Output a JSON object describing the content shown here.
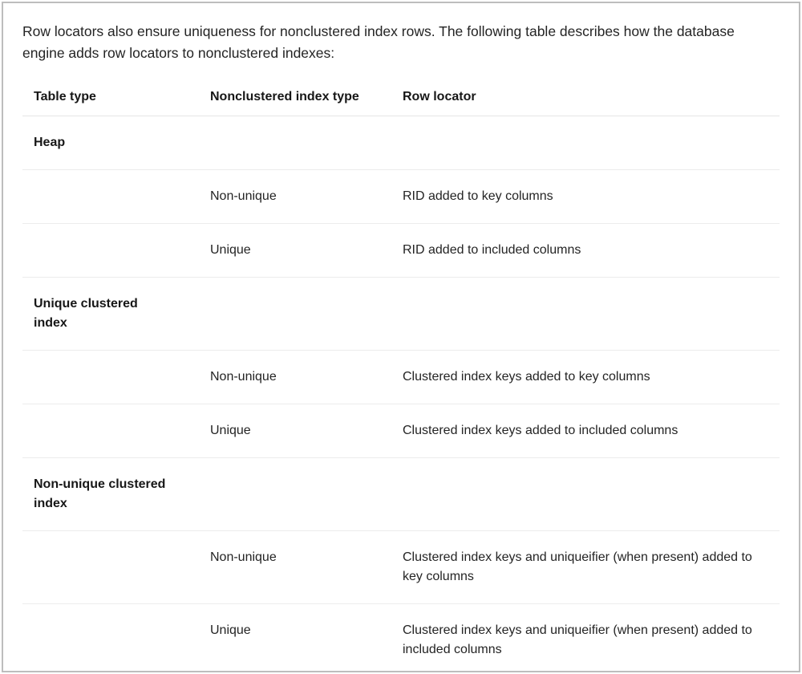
{
  "intro": "Row locators also ensure uniqueness for nonclustered index rows. The following table describes how the database engine adds row locators to nonclustered indexes:",
  "headers": {
    "col1": "Table type",
    "col2": "Nonclustered index type",
    "col3": "Row locator"
  },
  "rows": [
    {
      "c1": "Heap",
      "c2": "",
      "c3": "",
      "group": true
    },
    {
      "c1": "",
      "c2": "Non-unique",
      "c3": "RID added to key columns",
      "group": false
    },
    {
      "c1": "",
      "c2": "Unique",
      "c3": "RID added to included columns",
      "group": false
    },
    {
      "c1": "Unique clustered index",
      "c2": "",
      "c3": "",
      "group": true
    },
    {
      "c1": "",
      "c2": "Non-unique",
      "c3": "Clustered index keys added to key columns",
      "group": false
    },
    {
      "c1": "",
      "c2": "Unique",
      "c3": "Clustered index keys added to included columns",
      "group": false
    },
    {
      "c1": "Non-unique clustered index",
      "c2": "",
      "c3": "",
      "group": true
    },
    {
      "c1": "",
      "c2": "Non-unique",
      "c3": "Clustered index keys and uniqueifier (when present) added to key columns",
      "group": false
    },
    {
      "c1": "",
      "c2": "Unique",
      "c3": "Clustered index keys and uniqueifier (when present) added to included columns",
      "group": false
    }
  ]
}
